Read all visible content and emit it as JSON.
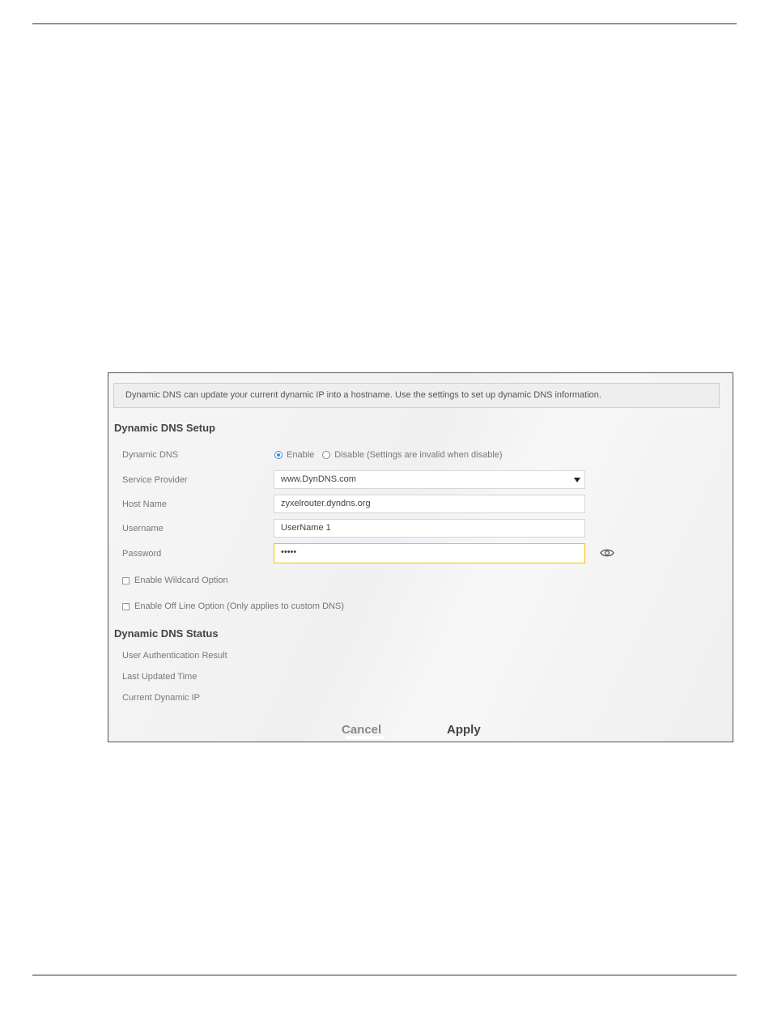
{
  "info_text": "Dynamic DNS can update your current dynamic IP into a hostname. Use the settings to set up dynamic DNS information.",
  "setup": {
    "title": "Dynamic DNS Setup",
    "dynamic_dns_label": "Dynamic DNS",
    "enable_label": "Enable",
    "disable_label": "Disable (Settings are invalid when disable)",
    "selected": "Enable",
    "service_provider_label": "Service Provider",
    "service_provider_value": "www.DynDNS.com",
    "host_name_label": "Host Name",
    "host_name_value": "zyxelrouter.dyndns.org",
    "username_label": "Username",
    "username_value": "UserName 1",
    "password_label": "Password",
    "password_value": "•••••",
    "wildcard_label": "Enable Wildcard Option",
    "wildcard_checked": false,
    "offline_label": "Enable Off Line Option (Only applies to custom DNS)",
    "offline_checked": false
  },
  "status": {
    "title": "Dynamic DNS Status",
    "auth_result_label": "User Authentication Result",
    "last_updated_label": "Last Updated Time",
    "current_ip_label": "Current Dynamic IP"
  },
  "buttons": {
    "cancel": "Cancel",
    "apply": "Apply"
  },
  "colors": {
    "accent": "#f5c400",
    "radio": "#3a8fd8"
  }
}
